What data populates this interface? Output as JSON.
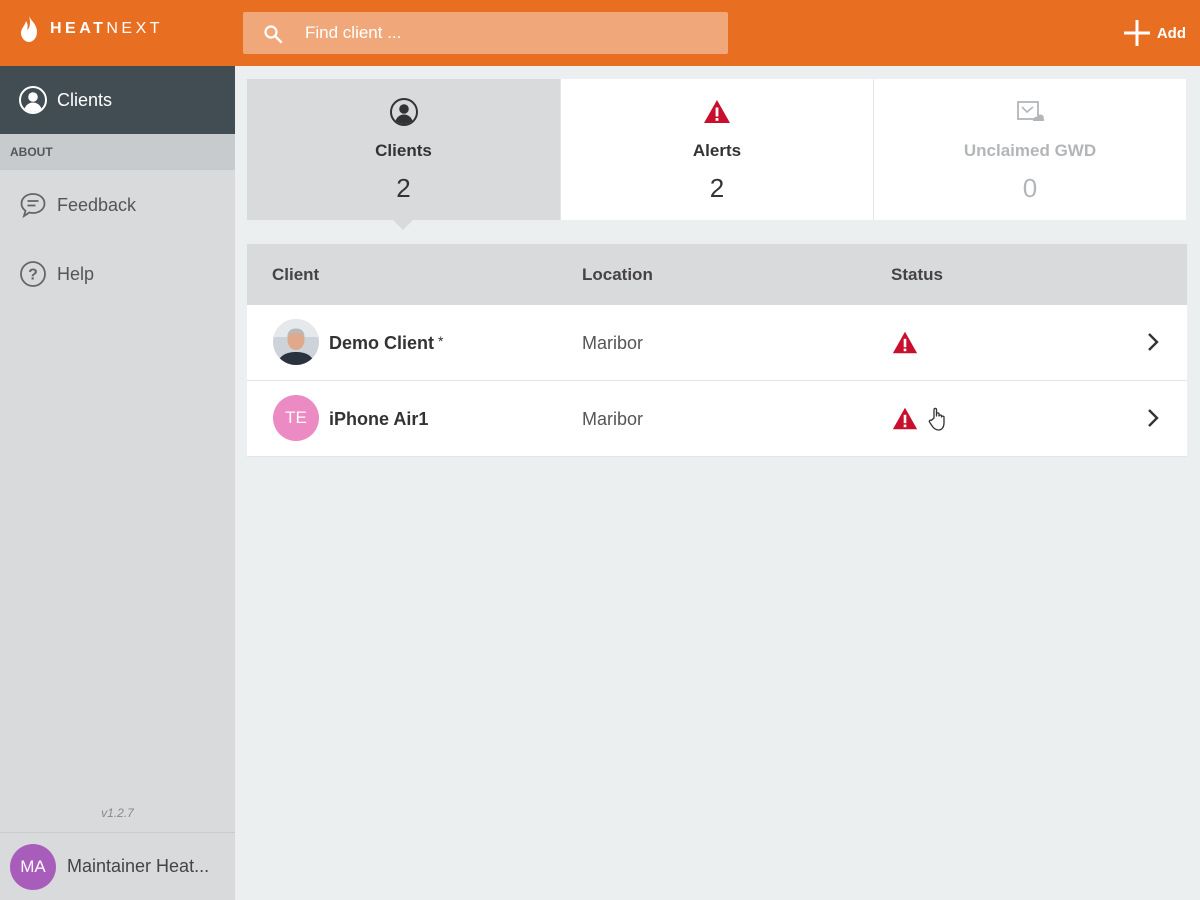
{
  "brand": {
    "name_bold": "HEAT",
    "name_light": "NEXT"
  },
  "search": {
    "placeholder": "Find client ..."
  },
  "header": {
    "add_label": "Add"
  },
  "sidebar": {
    "active_item": {
      "label": "Clients",
      "icon": "account-circle-icon"
    },
    "section_header": "ABOUT",
    "items": [
      {
        "label": "Feedback",
        "icon": "chat-bubble-icon"
      },
      {
        "label": "Help",
        "icon": "question-circle-icon"
      }
    ],
    "version": "v1.2.7",
    "user": {
      "initials": "MA",
      "name": "Maintainer Heat..."
    }
  },
  "summary_cards": [
    {
      "label": "Clients",
      "count": "2",
      "icon": "account-circle-icon",
      "active": true
    },
    {
      "label": "Alerts",
      "count": "2",
      "icon": "warning-icon"
    },
    {
      "label": "Unclaimed GWD",
      "count": "0",
      "icon": "device-image-icon",
      "disabled": true
    }
  ],
  "table": {
    "columns": [
      "Client",
      "Location",
      "Status"
    ],
    "rows": [
      {
        "name": "Demo Client",
        "marker": "*",
        "location": "Maribor",
        "status": "alert"
      },
      {
        "initials": "TE",
        "name": "iPhone Air1",
        "location": "Maribor",
        "status": "alert"
      }
    ]
  },
  "colors": {
    "topbar": "#e86e21",
    "sidebar_active": "#414c53",
    "alert": "#c8102e",
    "user_avatar": "#a95dbb",
    "client_avatar": "#ec8ac3"
  }
}
